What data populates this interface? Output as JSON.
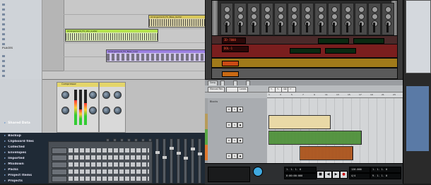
{
  "browser": {
    "items": [
      "",
      "",
      "",
      "",
      "",
      "",
      "",
      "",
      "",
      "",
      "",
      "",
      "",
      ""
    ],
    "places_label": "PLACES"
  },
  "arrangement": {
    "clips": [
      {
        "label": "Arrangement_FX_Bass_Guitar",
        "color": "#d9c85a"
      },
      {
        "label": "Arrangement_FX_Vox_Guitar",
        "color": "#b5e34e"
      },
      {
        "label": "Arrangement_FX_Bass_Loop",
        "color": "#9a7fe0"
      }
    ]
  },
  "devices": {
    "compressor": {
      "title": "Compressor"
    },
    "eq": {
      "title": ""
    }
  },
  "bottom_list": {
    "items": [
      "Backup",
      "Clipboard files",
      "Collected",
      "Envelopes",
      "Imported",
      "Mixdown",
      "Packs",
      "Project Items",
      "Projects"
    ],
    "folder_label": "Shared Data"
  },
  "mixer": {
    "rows": [
      "",
      "",
      "",
      "",
      ""
    ]
  },
  "rack": {
    "device_name": "ID-7000",
    "synth_label": "DOL-1",
    "lcds": [
      "",
      "",
      "",
      ""
    ]
  },
  "sequencer": {
    "tabs": [
      "Song",
      "",
      "",
      ""
    ],
    "tools": [
      "Manual Rec",
      "",
      "Lanes"
    ],
    "ruler_ticks": [
      "1",
      "3",
      "5",
      "7",
      "9",
      "11",
      "13",
      "15",
      "17",
      "19",
      "21",
      "23"
    ],
    "tracks": [
      {
        "name": "Blocks",
        "color": "#a0a3a6"
      },
      {
        "name": "",
        "color": "#b79b5a"
      },
      {
        "name": "",
        "color": "#5aa845"
      },
      {
        "name": "",
        "color": "#e0782d"
      },
      {
        "name": "",
        "color": "#9a9da1"
      }
    ],
    "transport": {
      "position": "1. 1. 1. 0",
      "time": "0:00:00:000",
      "tempo": "120.000",
      "signature": "4/4",
      "loop_left": "1. 1. 1. 0",
      "loop_right": "9. 1. 1. 0"
    }
  },
  "colors": {
    "accent": "#f1a230",
    "lcd_green": "#5cf27a",
    "lcd_red": "#ff5a3a"
  }
}
